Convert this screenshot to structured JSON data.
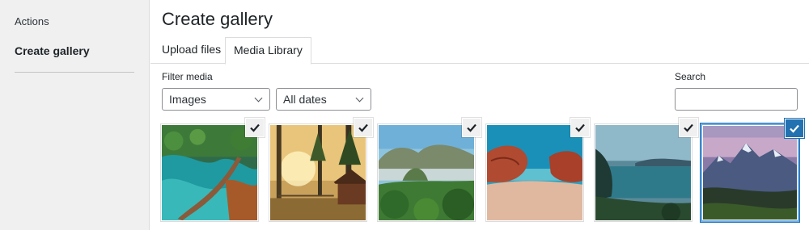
{
  "sidebar": {
    "items": [
      {
        "label": "Actions"
      },
      {
        "label": "Create gallery"
      }
    ]
  },
  "main": {
    "title": "Create gallery",
    "tabs": [
      {
        "label": "Upload files"
      },
      {
        "label": "Media Library",
        "active": true
      }
    ],
    "filter": {
      "label": "Filter media",
      "type_value": "Images",
      "date_value": "All dates"
    },
    "search": {
      "label": "Search",
      "value": ""
    },
    "attachments": [
      {
        "subject": "turquoise river with wooden boardwalk",
        "selected": false
      },
      {
        "subject": "sunlit forest with wooden cabin",
        "selected": false
      },
      {
        "subject": "misty green mountains over jungle",
        "selected": false
      },
      {
        "subject": "red rock arch on sandy beach",
        "selected": false
      },
      {
        "subject": "calm lake with distant mountains",
        "selected": false
      },
      {
        "subject": "snowy mountain range at dusk",
        "selected": true
      }
    ]
  },
  "colors": {
    "accent": "#2271b1",
    "selection_border": "#72aee6"
  }
}
